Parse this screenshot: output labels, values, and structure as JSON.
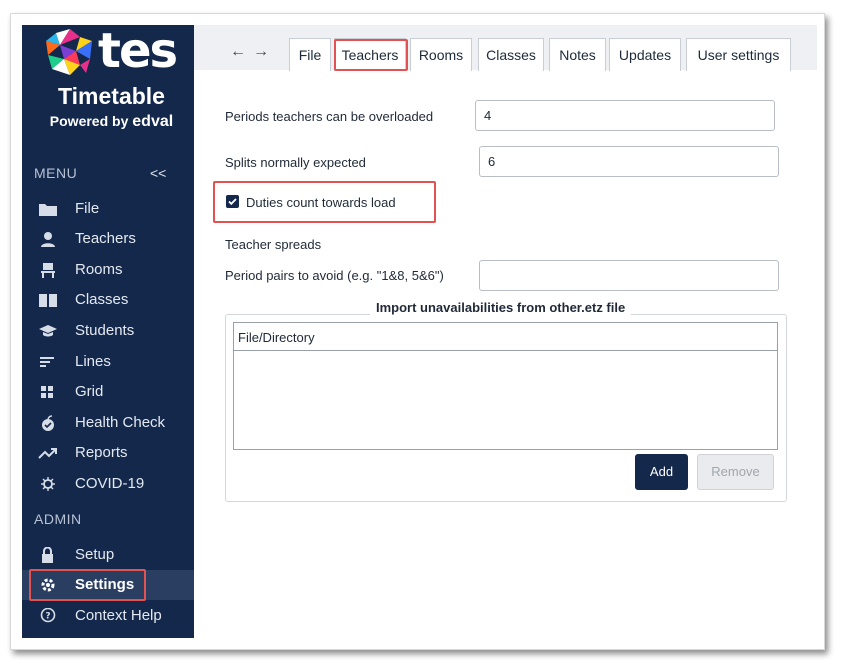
{
  "brand": {
    "wordmark": "tes",
    "product": "Timetable",
    "powered_prefix": "Powered by",
    "powered_brand": "edval"
  },
  "sidebar": {
    "menu_heading": "MENU",
    "collapse_label": "<<",
    "admin_heading": "ADMIN",
    "menu_items": [
      {
        "label": "File",
        "icon": "folder-icon"
      },
      {
        "label": "Teachers",
        "icon": "person-icon"
      },
      {
        "label": "Rooms",
        "icon": "chair-icon"
      },
      {
        "label": "Classes",
        "icon": "book-icon"
      },
      {
        "label": "Students",
        "icon": "graduation-cap-icon"
      },
      {
        "label": "Lines",
        "icon": "lines-icon"
      },
      {
        "label": "Grid",
        "icon": "grid-icon"
      },
      {
        "label": "Health Check",
        "icon": "apple-icon"
      },
      {
        "label": "Reports",
        "icon": "trend-icon"
      },
      {
        "label": "COVID-19",
        "icon": "virus-icon"
      }
    ],
    "admin_items": [
      {
        "label": "Setup",
        "icon": "lock-icon"
      },
      {
        "label": "Settings",
        "icon": "gear-icon",
        "active": true
      },
      {
        "label": "Context Help",
        "icon": "help-bubble-icon"
      }
    ]
  },
  "nav": {
    "back": "←",
    "forward": "→",
    "tabs": [
      "File",
      "Teachers",
      "Rooms",
      "Classes",
      "Notes",
      "Updates",
      "User settings"
    ],
    "active_tab": "Teachers"
  },
  "form": {
    "overload_label": "Periods teachers can be overloaded",
    "overload_value": "4",
    "splits_label": "Splits normally expected",
    "splits_value": "6",
    "duties_label": "Duties count towards load",
    "duties_checked": true,
    "spreads_heading": "Teacher spreads",
    "pairs_label": "Period pairs to avoid (e.g. \"1&8, 5&6\")",
    "pairs_value": ""
  },
  "import": {
    "legend": "Import unavailabilities from other.etz file",
    "column_header": "File/Directory",
    "rows": [],
    "add_label": "Add",
    "remove_label": "Remove"
  },
  "colors": {
    "sidebar_bg": "#14284b",
    "highlight": "#e15252",
    "primary_button": "#14284b"
  }
}
